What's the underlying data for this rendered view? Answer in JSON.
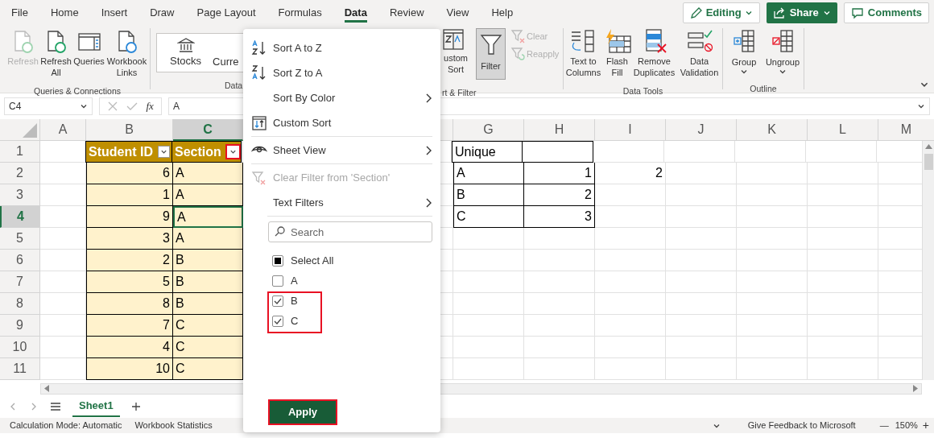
{
  "ribbon_tabs": [
    {
      "label": "File",
      "selected": false
    },
    {
      "label": "Home",
      "selected": false
    },
    {
      "label": "Insert",
      "selected": false
    },
    {
      "label": "Draw",
      "selected": false
    },
    {
      "label": "Page Layout",
      "selected": false
    },
    {
      "label": "Formulas",
      "selected": false
    },
    {
      "label": "Data",
      "selected": true
    },
    {
      "label": "Review",
      "selected": false
    },
    {
      "label": "View",
      "selected": false
    },
    {
      "label": "Help",
      "selected": false
    }
  ],
  "header_buttons": [
    {
      "kind": "editing",
      "label": "Editing"
    },
    {
      "kind": "share",
      "label": "Share"
    },
    {
      "kind": "comments",
      "label": "Comments"
    }
  ],
  "ribbon": {
    "queries_group": {
      "label": "Queries & Connections",
      "buttons": [
        {
          "label": "Refresh",
          "disabled": true
        },
        {
          "label": "Refresh All",
          "disabled": false
        },
        {
          "label": "Queries",
          "disabled": false
        },
        {
          "label": "Workbook Links",
          "disabled": false
        }
      ]
    },
    "data_types_group": {
      "label": "Data",
      "buttons": [
        {
          "label": "Stocks"
        },
        {
          "label": "Curre"
        }
      ]
    },
    "sort_filter_group": {
      "label": "rt & Filter",
      "custom_sort": "ustom Sort",
      "filter": {
        "label": "Filter",
        "selected": true
      },
      "small_buttons": [
        {
          "label": "Clear",
          "disabled": true
        },
        {
          "label": "Reapply",
          "disabled": true
        }
      ]
    },
    "data_tools_group": {
      "label": "Data Tools",
      "buttons": [
        {
          "label": "Text to Columns"
        },
        {
          "label": "Flash Fill"
        },
        {
          "label": "Remove Duplicates"
        },
        {
          "label": "Data Validation"
        }
      ]
    },
    "outline_group": {
      "label": "Outline",
      "buttons": [
        {
          "label": "Group"
        },
        {
          "label": "Ungroup"
        }
      ]
    }
  },
  "formula_bar": {
    "name_box": "C4",
    "function_label": "fx",
    "value": "A"
  },
  "sheet": {
    "columns": [
      {
        "label": "A",
        "selected": false
      },
      {
        "label": "B",
        "selected": false
      },
      {
        "label": "C",
        "selected": true
      },
      {
        "label": "G",
        "selected": false
      },
      {
        "label": "H",
        "selected": false
      },
      {
        "label": "I",
        "selected": false
      },
      {
        "label": "J",
        "selected": false
      },
      {
        "label": "K",
        "selected": false
      },
      {
        "label": "L",
        "selected": false
      },
      {
        "label": "M",
        "selected": false
      }
    ],
    "rows": [
      {
        "number": "1",
        "selected": false
      },
      {
        "number": "2",
        "selected": false
      },
      {
        "number": "3",
        "selected": false
      },
      {
        "number": "4",
        "selected": true
      },
      {
        "number": "5",
        "selected": false
      },
      {
        "number": "6",
        "selected": false
      },
      {
        "number": "7",
        "selected": false
      },
      {
        "number": "8",
        "selected": false
      },
      {
        "number": "9",
        "selected": false
      },
      {
        "number": "10",
        "selected": false
      },
      {
        "number": "11",
        "selected": false
      }
    ],
    "student_table": {
      "header": [
        {
          "label": "Student ID",
          "highlighted": false
        },
        {
          "label": "Section",
          "highlighted": true
        }
      ],
      "rows": [
        {
          "id": "6",
          "section": "A",
          "active": false
        },
        {
          "id": "1",
          "section": "A",
          "active": false
        },
        {
          "id": "9",
          "section": "A",
          "active": true
        },
        {
          "id": "3",
          "section": "A",
          "active": false
        },
        {
          "id": "2",
          "section": "B",
          "active": false
        },
        {
          "id": "5",
          "section": "B",
          "active": false
        },
        {
          "id": "8",
          "section": "B",
          "active": false
        },
        {
          "id": "7",
          "section": "C",
          "active": false
        },
        {
          "id": "4",
          "section": "C",
          "active": false
        },
        {
          "id": "10",
          "section": "C",
          "active": false
        }
      ]
    },
    "unique_table": {
      "header": "Unique",
      "rows": [
        {
          "label": "A",
          "count": "1"
        },
        {
          "label": "B",
          "count": "2"
        },
        {
          "label": "C",
          "count": "3"
        }
      ]
    },
    "cell_i2": "2"
  },
  "filter_menu": {
    "items": [
      {
        "kind": "item",
        "label": "Sort A to Z",
        "disabled": false,
        "submenu": false
      },
      {
        "kind": "item",
        "label": "Sort Z to A",
        "disabled": false,
        "submenu": false
      },
      {
        "kind": "item",
        "label": "Sort By Color",
        "disabled": false,
        "submenu": true
      },
      {
        "kind": "item",
        "label": "Custom Sort",
        "disabled": false,
        "submenu": false
      },
      {
        "kind": "divider"
      },
      {
        "kind": "item",
        "label": "Sheet View",
        "disabled": false,
        "submenu": true
      },
      {
        "kind": "divider"
      },
      {
        "kind": "item",
        "label": "Clear Filter from 'Section'",
        "disabled": true,
        "submenu": false
      },
      {
        "kind": "item",
        "label": "Text Filters",
        "disabled": false,
        "submenu": true
      }
    ],
    "search": {
      "placeholder": "Search"
    },
    "values": [
      {
        "label": "Select All",
        "checked": true,
        "partial": true,
        "highlighted": false
      },
      {
        "label": "A",
        "checked": false,
        "partial": false,
        "highlighted": false
      },
      {
        "label": "B",
        "checked": true,
        "partial": false,
        "highlighted": true
      },
      {
        "label": "C",
        "checked": true,
        "partial": false,
        "highlighted": true
      }
    ],
    "apply": {
      "label": "Apply",
      "highlighted": true
    }
  },
  "sheet_tabs": [
    {
      "label": "Sheet1",
      "selected": true
    }
  ],
  "status_bar": {
    "left": [
      "Calculation Mode: Automatic",
      "Workbook Statistics"
    ],
    "feedback": "Give Feedback to Microsoft",
    "zoom_out": "—",
    "zoom": "150%",
    "zoom_in": "+"
  }
}
